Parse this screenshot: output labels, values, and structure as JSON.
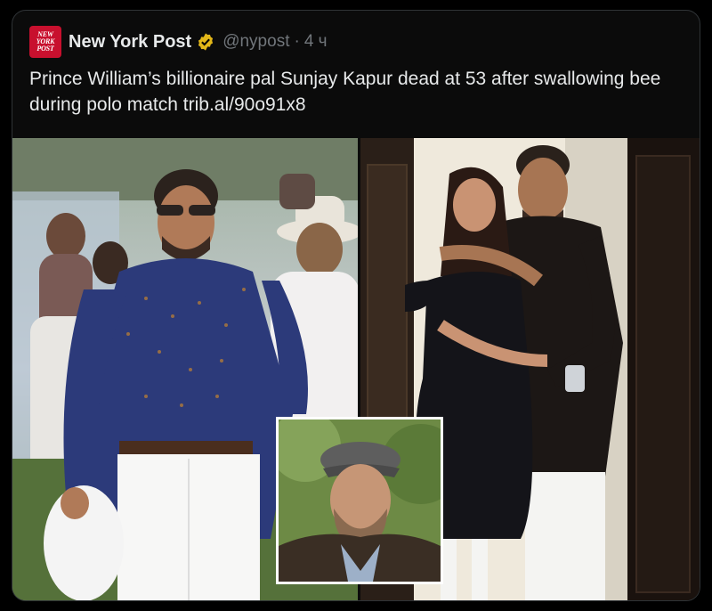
{
  "tweet": {
    "author_name": "New York Post",
    "avatar_text": [
      "NEW",
      "YORK",
      "POST"
    ],
    "handle": "@nypost",
    "separator": "·",
    "time": "4 ч",
    "text": "Prince William’s billionaire pal Sunjay Kapur dead at 53 after swallowing bee during polo match ",
    "link": "trib.al/90o91x8"
  },
  "icons": {
    "verified": "verified-badge-icon"
  },
  "colors": {
    "background": "#000000",
    "brand": "#c8102e",
    "verified_gold": "#e2b719",
    "secondary_text": "#71767b"
  }
}
